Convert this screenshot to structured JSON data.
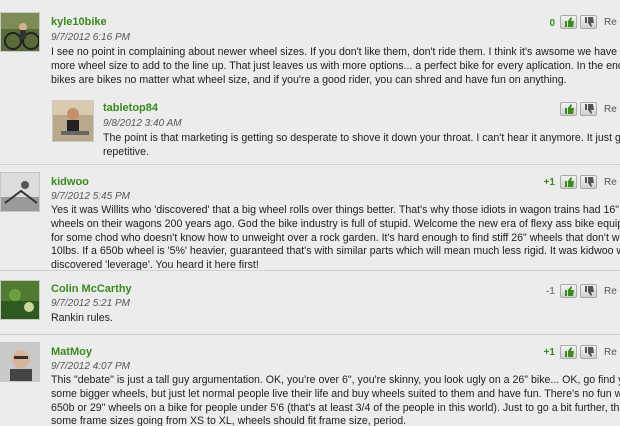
{
  "comments": [
    {
      "username": "kyle10bike",
      "date": "9/7/2012 6:16 PM",
      "score": "0",
      "reply_label": "Re",
      "lines": [
        "I see no point in complaining about newer wheel sizes. If you don't like them, don't ride them. I think it's awsome we have one",
        "more wheel size to add to the line up. That just leaves us with more options... a perfect bike for every aplication. In the end",
        "bikes are bikes no matter what wheel size, and if you're a good rider, you can shred and have fun on anything."
      ]
    },
    {
      "username": "tabletop84",
      "date": "9/8/2012 3:40 AM",
      "score": "",
      "reply_label": "Re",
      "lines": [
        "The point is that marketing is getting so desperate to shove it down your throat. I can't hear it anymore. It just gets",
        "repetitive."
      ]
    },
    {
      "username": "kidwoo",
      "date": "9/7/2012 5:45 PM",
      "score": "+1",
      "reply_label": "Re",
      "lines": [
        "Yes it was Willits who 'discovered' that a big wheel rolls over things better. That's why those idiots in wagon trains had 16\"",
        "wheels on their wagons 200 years ago. God the bike industry is full of stupid. Welcome the new era of flexy ass bike equipme",
        "for some chod who doesn't know how to unweight over a rock garden. It's hard enough to find stiff 26\" wheels that don't weig",
        "10lbs. If a 650b wheel is '5%' heavier, guaranteed that's with similar parts which will mean much less rigid. It was kidwoo who",
        "discovered 'leverage'. You heard it here first!"
      ]
    },
    {
      "username": "Colin McCarthy",
      "date": "9/7/2012 5:21 PM",
      "score": "-1",
      "reply_label": "Re",
      "lines": [
        "Rankin rules."
      ]
    },
    {
      "username": "MatMoy",
      "date": "9/7/2012 4:07 PM",
      "score": "+1",
      "reply_label": "Re",
      "lines": [
        "This \"debate\" is just a tall guy argumentation. OK, you're over 6\", you're skinny, you look ugly on a 26\" bike... OK, go find yours",
        "some bigger wheels, but just let normal people live their life and buy wheels suited to them and have fun. There's no fun with",
        "650b or 29\" wheels on a bike for people under 5'6 (that's at least 3/4 of the people in this world). Just to go a bit further, there's",
        "some frame sizes going from XS to XL, wheels should fit frame size, period."
      ]
    }
  ]
}
